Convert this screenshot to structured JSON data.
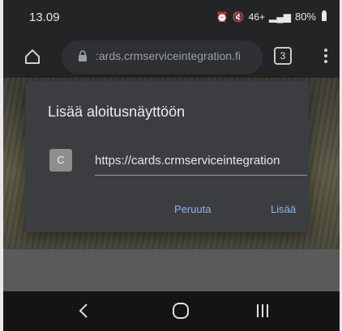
{
  "status_bar": {
    "time": "13.09",
    "signal_text": "46+",
    "battery": "80%"
  },
  "browser": {
    "url": ":ards.crmserviceintegration.fi",
    "tab_count": "3"
  },
  "dialog": {
    "title": "Lisää aloitusnäyttöön",
    "favicon_letter": "C",
    "name_value": "https://cards.crmserviceintegration",
    "cancel_label": "Peruuta",
    "add_label": "Lisää"
  },
  "colors": {
    "accent": "#8ab4f8",
    "dialog_bg": "#3c3d40"
  }
}
